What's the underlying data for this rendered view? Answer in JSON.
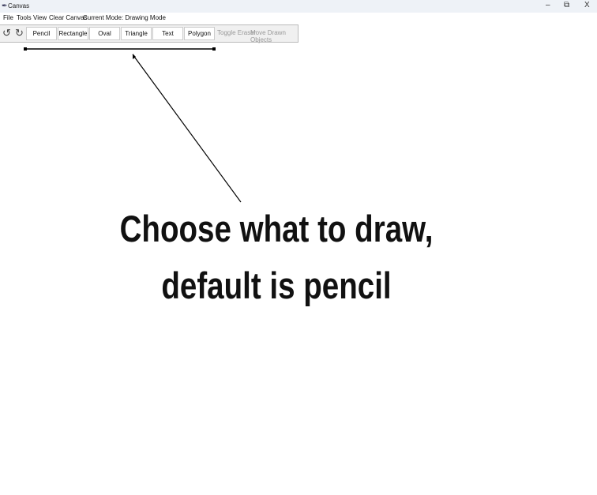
{
  "window": {
    "title": "Canvas",
    "minimize": "–",
    "restore": "⧉",
    "close": "X"
  },
  "menu": {
    "file": "File",
    "tools": "Tools",
    "view": "View",
    "clear": "Clear Canvas",
    "mode": "Current Mode: Drawing Mode"
  },
  "toolbar": {
    "undo": "↺",
    "redo": "↻",
    "buttons": [
      "Pencil",
      "Rectangle",
      "Oval",
      "Triangle",
      "Text",
      "Polygon"
    ],
    "toggle_eraser": "Toggle Eraser",
    "move": "Move Drawn Objects"
  },
  "annotation": {
    "line1": "Choose what to draw,",
    "line2": "default is pencil"
  }
}
